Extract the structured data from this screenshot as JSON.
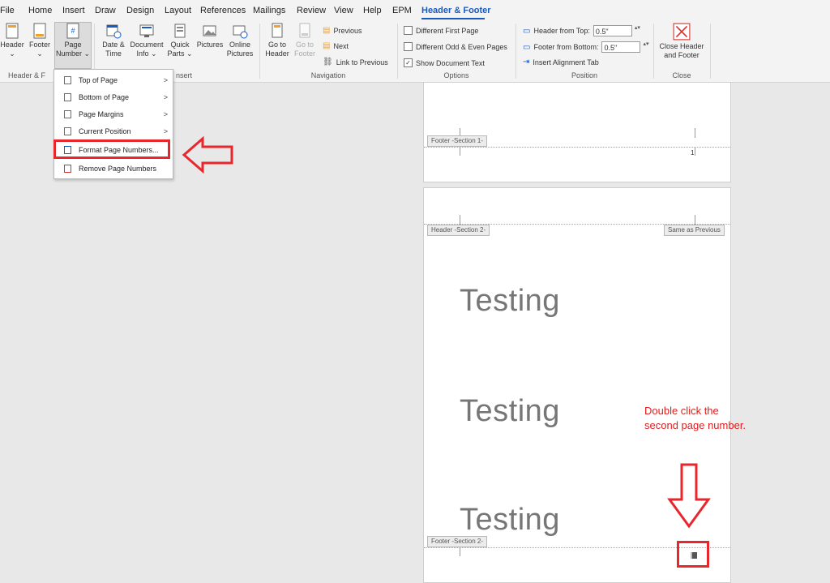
{
  "tabs": [
    "File",
    "Home",
    "Insert",
    "Draw",
    "Design",
    "Layout",
    "References",
    "Mailings",
    "Review",
    "View",
    "Help",
    "EPM",
    "Header & Footer"
  ],
  "ribbon": {
    "header_footer_group": {
      "label": "Header & F",
      "buttons": [
        {
          "label1": "Header",
          "label2": "⌄"
        },
        {
          "label1": "Footer",
          "label2": "⌄"
        },
        {
          "label1": "Page",
          "label2": "Number ⌄"
        }
      ]
    },
    "insert_group": {
      "label": "nsert",
      "buttons": [
        {
          "label1": "Date &",
          "label2": "Time"
        },
        {
          "label1": "Document",
          "label2": "Info ⌄"
        },
        {
          "label1": "Quick",
          "label2": "Parts ⌄"
        },
        {
          "label1": "Pictures",
          "label2": ""
        },
        {
          "label1": "Online",
          "label2": "Pictures"
        }
      ]
    },
    "navigation_group": {
      "label": "Navigation",
      "go_to_header": {
        "label1": "Go to",
        "label2": "Header"
      },
      "go_to_footer": {
        "label1": "Go to",
        "label2": "Footer"
      },
      "previous": "Previous",
      "next": "Next",
      "link_to_previous": "Link to Previous"
    },
    "options_group": {
      "label": "Options",
      "different_first_page": "Different First Page",
      "different_odd_even": "Different Odd & Even Pages",
      "show_document_text": "Show Document Text",
      "show_document_text_checked": "✓"
    },
    "position_group": {
      "label": "Position",
      "header_from_top_label": "Header from Top:",
      "header_from_top_value": "0.5\"",
      "footer_from_bottom_label": "Footer from Bottom:",
      "footer_from_bottom_value": "0.5\"",
      "insert_alignment_tab": "Insert Alignment Tab"
    },
    "close_group": {
      "label": "Close",
      "close_label1": "Close Header",
      "close_label2": "and Footer",
      "close_icon": "close-x-icon"
    }
  },
  "menu": {
    "items": [
      {
        "label": "Top of Page",
        "has_submenu": ">"
      },
      {
        "label": "Bottom of Page",
        "has_submenu": ">"
      },
      {
        "label": "Page Margins",
        "has_submenu": ">"
      },
      {
        "label": "Current Position",
        "has_submenu": ">"
      },
      {
        "label": "Format Page Numbers...",
        "has_submenu": ""
      },
      {
        "label": "Remove Page Numbers",
        "has_submenu": ""
      }
    ]
  },
  "document": {
    "footer_section1_tag": "Footer -Section 1-",
    "page1_number": "1",
    "header_section2_tag": "Header -Section 2-",
    "same_as_previous_tag": "Same as Previous",
    "body_lines": [
      "Testing",
      "Testing",
      "Testing"
    ],
    "footer_section2_tag": "Footer -Section 2-"
  },
  "annotation": {
    "text_line1": "Double click the",
    "text_line2": "second page number.",
    "color": "#e8262b"
  }
}
